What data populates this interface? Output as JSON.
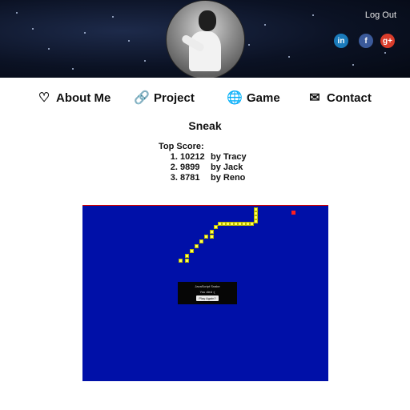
{
  "header": {
    "logout_label": "Log Out",
    "social": [
      {
        "name": "linkedin-icon",
        "glyph": "in",
        "color": "#1a7bbb"
      },
      {
        "name": "facebook-icon",
        "glyph": "f",
        "color": "#3b5a9a"
      },
      {
        "name": "google-plus-icon",
        "glyph": "g+",
        "color": "#d93c2b"
      }
    ]
  },
  "nav": {
    "items": [
      {
        "label": "About Me",
        "icon": "heart-icon",
        "glyph": "♡"
      },
      {
        "label": "Project",
        "icon": "link-icon",
        "glyph": "🔗"
      },
      {
        "label": "Game",
        "icon": "globe-icon",
        "glyph": "🌐"
      },
      {
        "label": "Contact",
        "icon": "mail-icon",
        "glyph": "✉"
      }
    ]
  },
  "page": {
    "title": "Sneak",
    "top_score_label": "Top Score:",
    "scores": [
      {
        "score": "10212",
        "by": "by Tracy"
      },
      {
        "score": "9899",
        "by": "by Jack"
      },
      {
        "score": "8781",
        "by": "by Reno"
      }
    ]
  },
  "game": {
    "dialog_title": "JavaScript Snake",
    "dialog_message": "You died :(",
    "play_again_label": "Play Again?",
    "colors": {
      "board": "#0010a8",
      "snake": "#ffff55",
      "food": "#ff1e1e",
      "border": "#d40000"
    }
  }
}
